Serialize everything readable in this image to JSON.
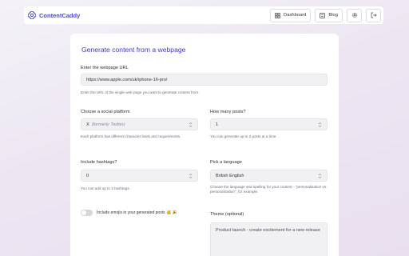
{
  "app": {
    "name": "ContentCaddy",
    "accent": "#4a4ad0"
  },
  "nav": {
    "dashboard_label": "Dashboard",
    "blog_label": "Blog"
  },
  "form": {
    "title": "Generate content from a webpage",
    "url": {
      "label": "Enter the webpage URL",
      "value": "https://www.apple.com/uk/iphone-16-pro/",
      "help": "Enter the URL of the single web page you want to generate content from."
    },
    "platform": {
      "label": "Choose a social platform",
      "value": "X",
      "value_note": "(formerly Twitter)",
      "help": "Each platform has different character limits and requirements."
    },
    "posts": {
      "label": "How many posts?",
      "value": "1",
      "help": "You can generate up to 3 posts at a time."
    },
    "hashtags": {
      "label": "Include hashtags?",
      "value": "0",
      "help": "You can add up to 3 hashtags."
    },
    "language": {
      "label": "Pick a language",
      "value": "British English",
      "help": "Choose the language and spelling for your content - \"personalisation vs. personalization\", for example."
    },
    "emoji": {
      "label": "Include emojis in your generated posts 🥳 🎉",
      "enabled": false
    },
    "theme": {
      "label": "Theme (optional)",
      "value": "Product launch - create excitement for a new release"
    }
  }
}
